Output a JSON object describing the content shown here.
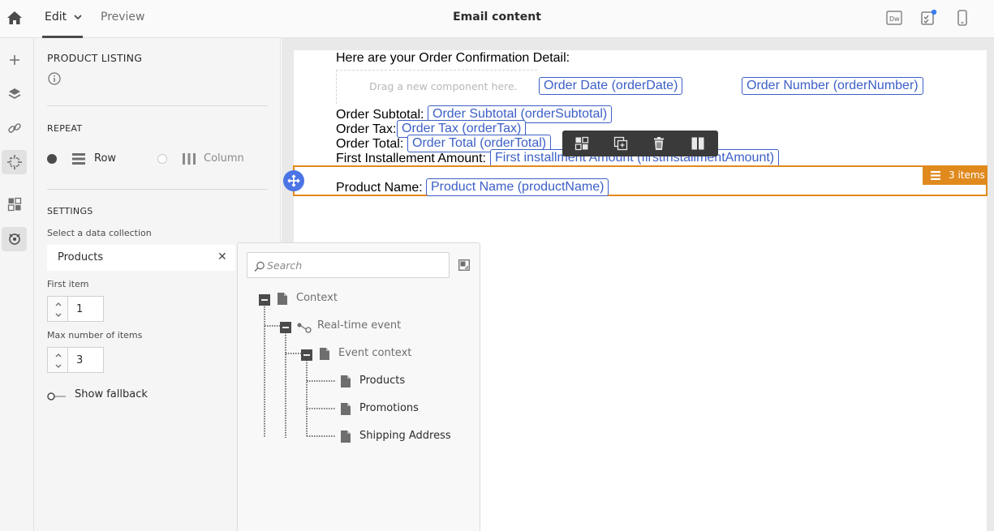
{
  "topbar": {
    "tabs": [
      {
        "label": "Edit"
      },
      {
        "label": "Preview"
      }
    ],
    "title": "Email content",
    "right_icons": [
      "dreamweaver-icon",
      "checklist-icon",
      "mobile-preview-icon"
    ]
  },
  "rail": {
    "items": [
      "add-icon",
      "layers-icon",
      "link-icon",
      "structure-icon",
      "components-icon",
      "personalization-icon"
    ]
  },
  "panel": {
    "title": "PRODUCT LISTING",
    "repeat_label": "REPEAT",
    "repeat_options": [
      {
        "label": "Row",
        "selected": true
      },
      {
        "label": "Column",
        "selected": false
      }
    ],
    "settings_label": "SETTINGS",
    "collection_label": "Select a data collection",
    "collection_value": "Products",
    "clear_glyph": "✕",
    "first_item_label": "First item",
    "first_item_value": "1",
    "max_items_label": "Max number of items",
    "max_items_value": "3",
    "fallback_label": "Show fallback"
  },
  "canvas": {
    "heading": "Here are your Order Confirmation Detail:",
    "drop_hint": "Drag a new component here.",
    "order_date_field": "Order Date (orderDate)",
    "order_number_field": "Order Number (orderNumber)",
    "rows": [
      {
        "label": "Order Subtotal:",
        "field": "Order Subtotal (orderSubtotal)"
      },
      {
        "label": "Order Tax:",
        "field": "Order Tax (orderTax)"
      },
      {
        "label": "Order Total:",
        "field": "Order Total (orderTotal)"
      },
      {
        "label": "First Installement Amount:",
        "field": "First installment Amount (firstInstallmentAmount)"
      }
    ],
    "product_label": "Product Name:",
    "product_field": "Product Name (productName)",
    "items_badge": "3 items"
  },
  "toolbar": [
    "components-icon",
    "duplicate-icon",
    "delete-icon",
    "columns-icon"
  ],
  "tree": {
    "search_placeholder": "Search",
    "nodes": [
      {
        "label": "Context"
      },
      {
        "label": "Real-time event"
      },
      {
        "label": "Event context"
      },
      {
        "label": "Products"
      },
      {
        "label": "Promotions"
      },
      {
        "label": "Shipping Address"
      }
    ]
  },
  "colors": {
    "accent_orange": "#e08a1e",
    "field_blue": "#3c5fc7",
    "handle_blue": "#4b74e5"
  }
}
